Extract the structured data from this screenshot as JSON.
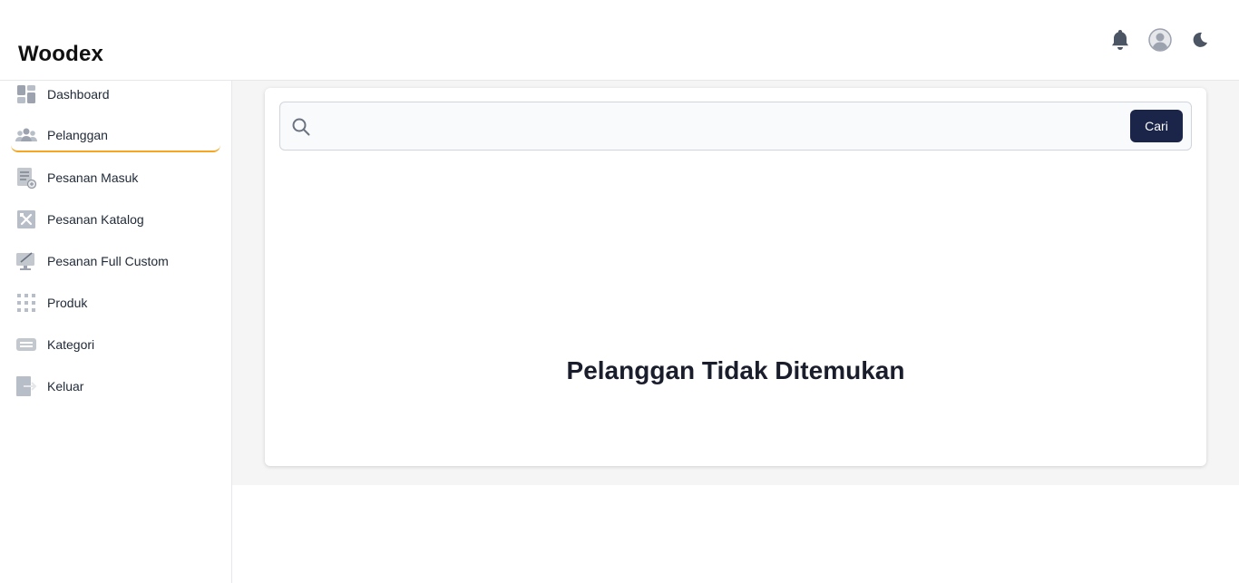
{
  "header": {
    "brand": "Woodex",
    "icons": [
      "bell-icon",
      "user-avatar-icon",
      "moon-icon"
    ]
  },
  "sidebar": {
    "items": [
      {
        "label": "Dashboard",
        "icon": "dashboard-icon"
      },
      {
        "label": "Pelanggan",
        "icon": "users-icon",
        "active": true
      },
      {
        "label": "Pesanan Masuk",
        "icon": "incoming-orders-icon"
      },
      {
        "label": "Pesanan Katalog",
        "icon": "catalog-tools-icon"
      },
      {
        "label": "Pesanan Full Custom",
        "icon": "custom-design-icon"
      },
      {
        "label": "Produk",
        "icon": "product-grid-icon"
      },
      {
        "label": "Kategori",
        "icon": "category-icon"
      },
      {
        "label": "Keluar",
        "icon": "logout-icon"
      }
    ]
  },
  "main": {
    "search": {
      "value": "",
      "placeholder": "",
      "button_label": "Cari"
    },
    "empty_message": "Pelanggan Tidak Ditemukan"
  },
  "colors": {
    "accent": "#f5a623",
    "button": "#1b2449",
    "icon_gray": "#9ca3af"
  }
}
